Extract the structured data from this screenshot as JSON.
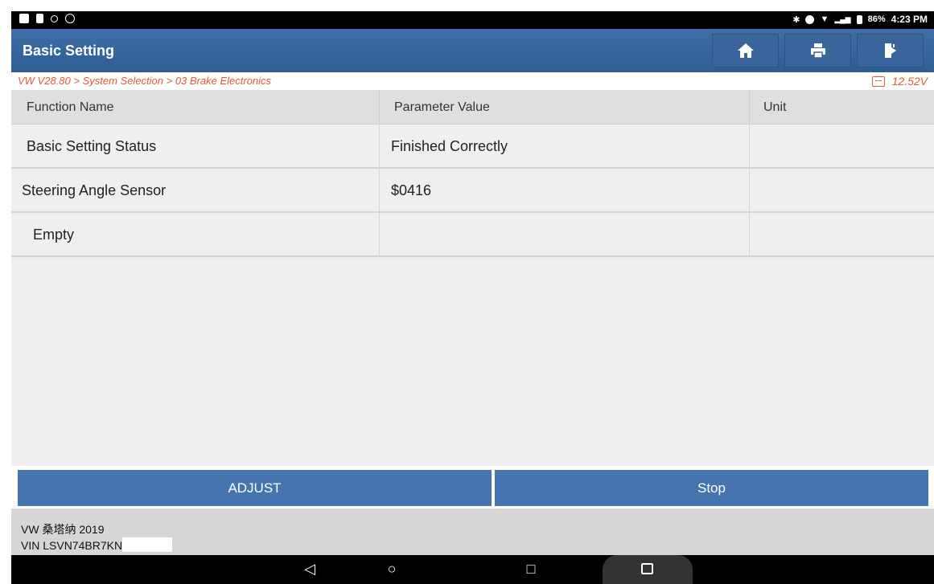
{
  "status_bar": {
    "battery": "86%",
    "time": "4:23 PM"
  },
  "header": {
    "title": "Basic Setting",
    "buttons": [
      {
        "icon": "home-icon"
      },
      {
        "icon": "print-icon"
      },
      {
        "icon": "exit-icon"
      }
    ]
  },
  "breadcrumb": {
    "path": "VW V28.80 > System Selection > 03 Brake Electronics",
    "voltage": "12.52V"
  },
  "table": {
    "columns": [
      "Function Name",
      "Parameter Value",
      "Unit"
    ],
    "rows": [
      {
        "name": "Basic Setting Status",
        "value": "Finished Correctly",
        "unit": ""
      },
      {
        "name": "Steering Angle Sensor",
        "value": "$0416",
        "unit": ""
      },
      {
        "name": "Empty",
        "value": "",
        "unit": ""
      }
    ]
  },
  "actions": {
    "adjust": "ADJUST",
    "stop": "Stop"
  },
  "footer": {
    "vehicle": "VW 桑塔纳 2019",
    "vin": "VIN LSVN74BR7KN"
  },
  "colors": {
    "header": "#3a659c",
    "accent": "#e2583a",
    "button": "#4674af"
  }
}
